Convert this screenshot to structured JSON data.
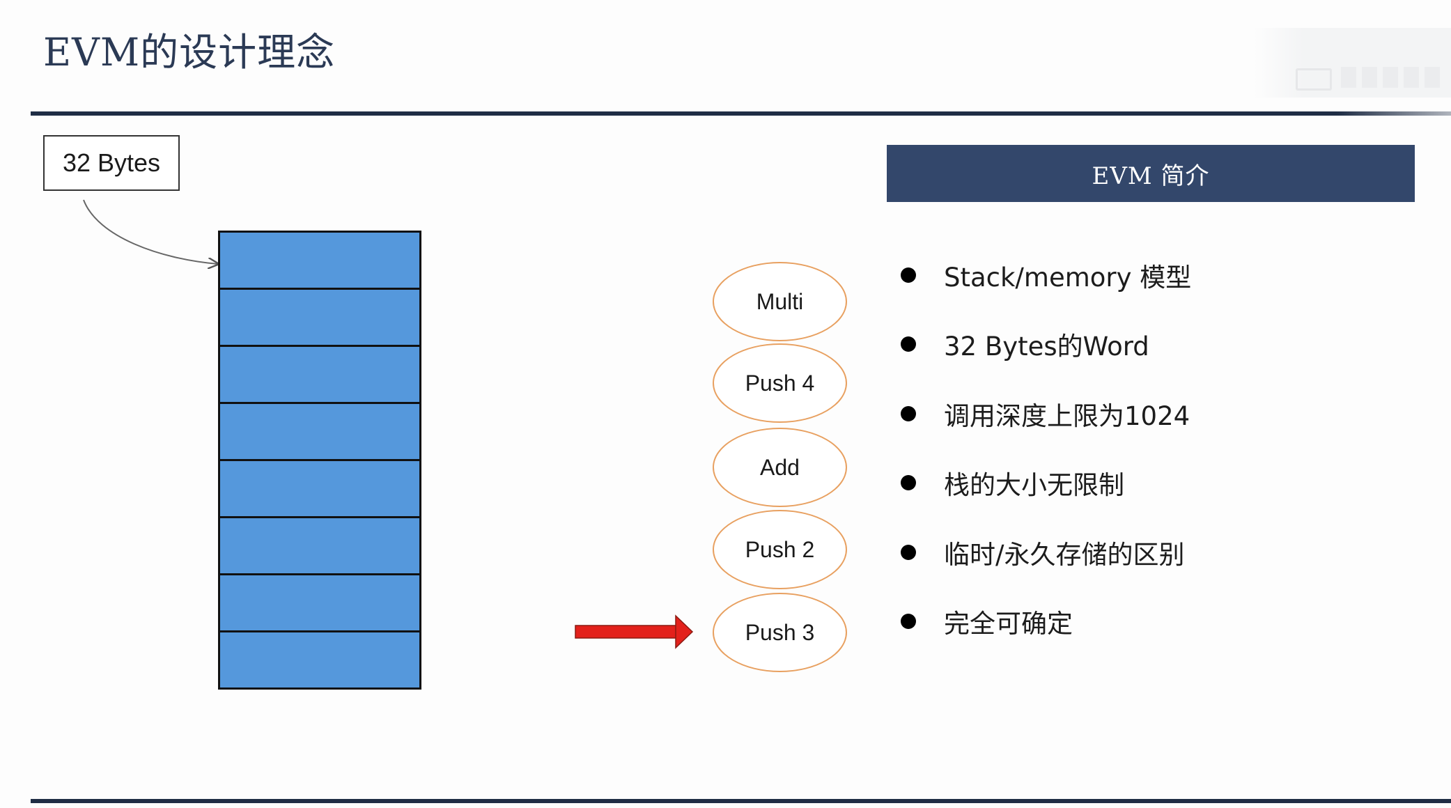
{
  "slide": {
    "title": "EVM的设计理念"
  },
  "colors": {
    "title": "#2b3a55",
    "rule": "#1f2d45",
    "stack_cell": "#5598dc",
    "op_border": "#e8a060",
    "arrow": "#e3211b",
    "panel_header_bg": "#33476b"
  },
  "diagram": {
    "word_callout": "32 Bytes",
    "stack_cells": 8,
    "operations": [
      {
        "label": "Multi"
      },
      {
        "label": "Push 4"
      },
      {
        "label": "Add"
      },
      {
        "label": "Push 2"
      },
      {
        "label": "Push 3"
      }
    ],
    "pointer_target": "Push 3"
  },
  "panel": {
    "header": "EVM 简介",
    "bullets": [
      "Stack/memory 模型",
      "32 Bytes的Word",
      "调用深度上限为1024",
      "栈的大小无限制",
      "临时/永久存储的区别",
      "完全可确定"
    ]
  }
}
